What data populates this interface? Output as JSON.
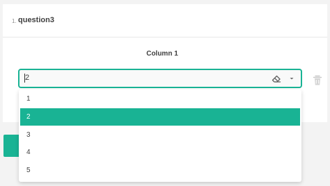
{
  "question": {
    "number": "1.",
    "title": "question3"
  },
  "matrix": {
    "column_header": "Column 1"
  },
  "dropdown": {
    "value": "2",
    "clear_icon": "eraser-icon",
    "expand_icon": "chevron-down-icon",
    "options": [
      "1",
      "2",
      "3",
      "4",
      "5"
    ],
    "selected_option": "2"
  },
  "row_actions": {
    "remove_icon": "trash-icon"
  },
  "colors": {
    "accent": "#19b394",
    "text": "#404040",
    "icon": "#909090",
    "background": "#f3f3f3"
  }
}
